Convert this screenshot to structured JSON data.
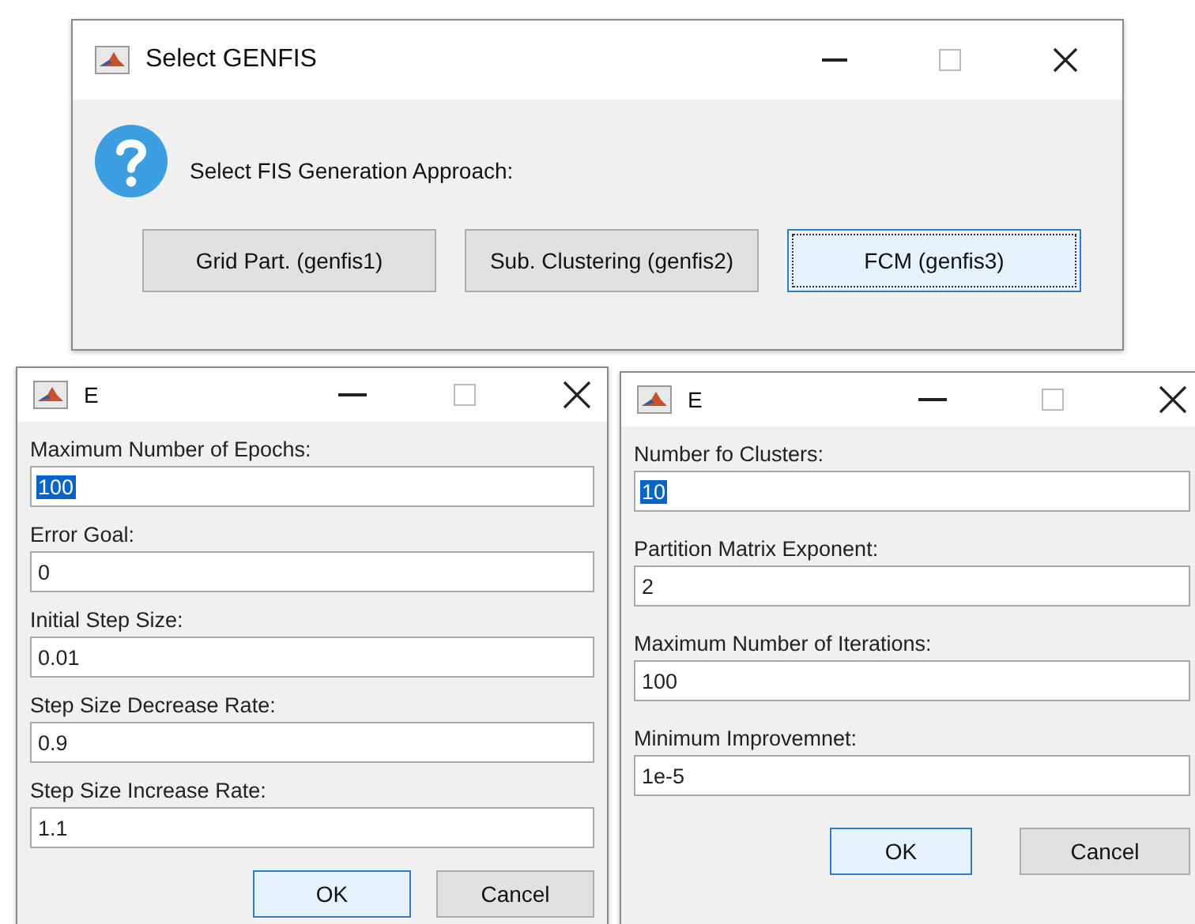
{
  "select_window": {
    "title": "Select GENFIS",
    "message": "Select FIS Generation Approach:",
    "buttons": [
      {
        "label": "Grid Part. (genfis1)",
        "focused": false
      },
      {
        "label": "Sub. Clustering (genfis2)",
        "focused": false
      },
      {
        "label": "FCM (genfis3)",
        "focused": true
      }
    ]
  },
  "dialogs": [
    {
      "title": "E",
      "fields": [
        {
          "label": "Maximum Number of Epochs:",
          "value": "100",
          "text_selected": true
        },
        {
          "label": "Error Goal:",
          "value": "0",
          "text_selected": false
        },
        {
          "label": "Initial Step Size:",
          "value": "0.01",
          "text_selected": false
        },
        {
          "label": "Step Size Decrease Rate:",
          "value": "0.9",
          "text_selected": false
        },
        {
          "label": "Step Size Increase Rate:",
          "value": "1.1",
          "text_selected": false
        }
      ],
      "buttons": [
        {
          "label": "OK",
          "focused": true
        },
        {
          "label": "Cancel",
          "focused": false
        }
      ]
    },
    {
      "title": "E",
      "fields": [
        {
          "label": "Number fo Clusters:",
          "value": "10",
          "text_selected": true
        },
        {
          "label": "Partition Matrix Exponent:",
          "value": "2",
          "text_selected": false
        },
        {
          "label": "Maximum Number of Iterations:",
          "value": "100",
          "text_selected": false
        },
        {
          "label": "Minimum Improvemnet:",
          "value": "1e-5",
          "text_selected": false
        }
      ],
      "buttons": [
        {
          "label": "OK",
          "focused": true
        },
        {
          "label": "Cancel",
          "focused": false
        }
      ]
    }
  ]
}
